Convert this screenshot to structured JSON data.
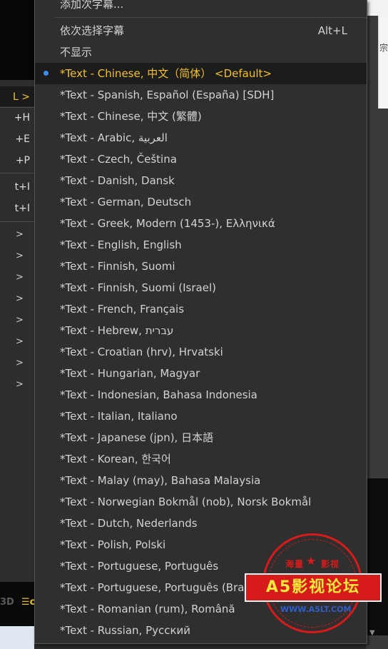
{
  "left_menu": {
    "highlight_label": "L >",
    "shortcuts": [
      "+H",
      "+E",
      "+P",
      "t+I",
      "t+I"
    ],
    "arrow": ">",
    "bottom_text": [
      "3D",
      "☰c"
    ]
  },
  "submenu": {
    "top_items": [
      {
        "label": "添加次字幕..."
      },
      {
        "label": "依次选择字幕",
        "shortcut": "Alt+L"
      },
      {
        "label": "不显示"
      }
    ],
    "tracks": [
      {
        "label": "*Text - Chinese, 中文（简体） <Default>",
        "active": true
      },
      {
        "label": "*Text - Spanish, Español (España) [SDH]"
      },
      {
        "label": "*Text - Chinese, 中文 (繁體)"
      },
      {
        "label": "*Text - Arabic, العربية"
      },
      {
        "label": "*Text - Czech, Čeština"
      },
      {
        "label": "*Text - Danish, Dansk"
      },
      {
        "label": "*Text - German, Deutsch"
      },
      {
        "label": "*Text - Greek, Modern (1453-), Ελληνικά"
      },
      {
        "label": "*Text - English, English"
      },
      {
        "label": "*Text - Finnish, Suomi"
      },
      {
        "label": "*Text - Finnish, Suomi (Israel)"
      },
      {
        "label": "*Text - French, Français"
      },
      {
        "label": "*Text - Hebrew, עברית"
      },
      {
        "label": "*Text - Croatian (hrv), Hrvatski"
      },
      {
        "label": "*Text - Hungarian, Magyar"
      },
      {
        "label": "*Text - Indonesian, Bahasa Indonesia"
      },
      {
        "label": "*Text - Italian, Italiano"
      },
      {
        "label": "*Text - Japanese (jpn), 日本語"
      },
      {
        "label": "*Text - Korean, 한국어"
      },
      {
        "label": "*Text - Malay (may), Bahasa Malaysia"
      },
      {
        "label": "*Text - Norwegian Bokmål (nob), Norsk Bokmål"
      },
      {
        "label": "*Text - Dutch, Nederlands"
      },
      {
        "label": "*Text - Polish, Polski"
      },
      {
        "label": "*Text - Portuguese, Português"
      },
      {
        "label": "*Text - Portuguese, Português (Brasil)"
      },
      {
        "label": "*Text - Romanian (rum), Română"
      },
      {
        "label": "*Text - Russian, Русский"
      }
    ]
  },
  "right_window": {
    "edge_text": "宗",
    "scroll_down_icon": "▼"
  },
  "watermark": {
    "top_left": "海量",
    "top_right": "影视",
    "star": "★",
    "banner": "A5影视论坛",
    "url": "WWW.A5LT.COM"
  },
  "colors": {
    "menu_bg": "#2f2f2f",
    "active_text": "#f2c22a",
    "bullet": "#3d8df0",
    "watermark_red": "#d71a1a"
  }
}
